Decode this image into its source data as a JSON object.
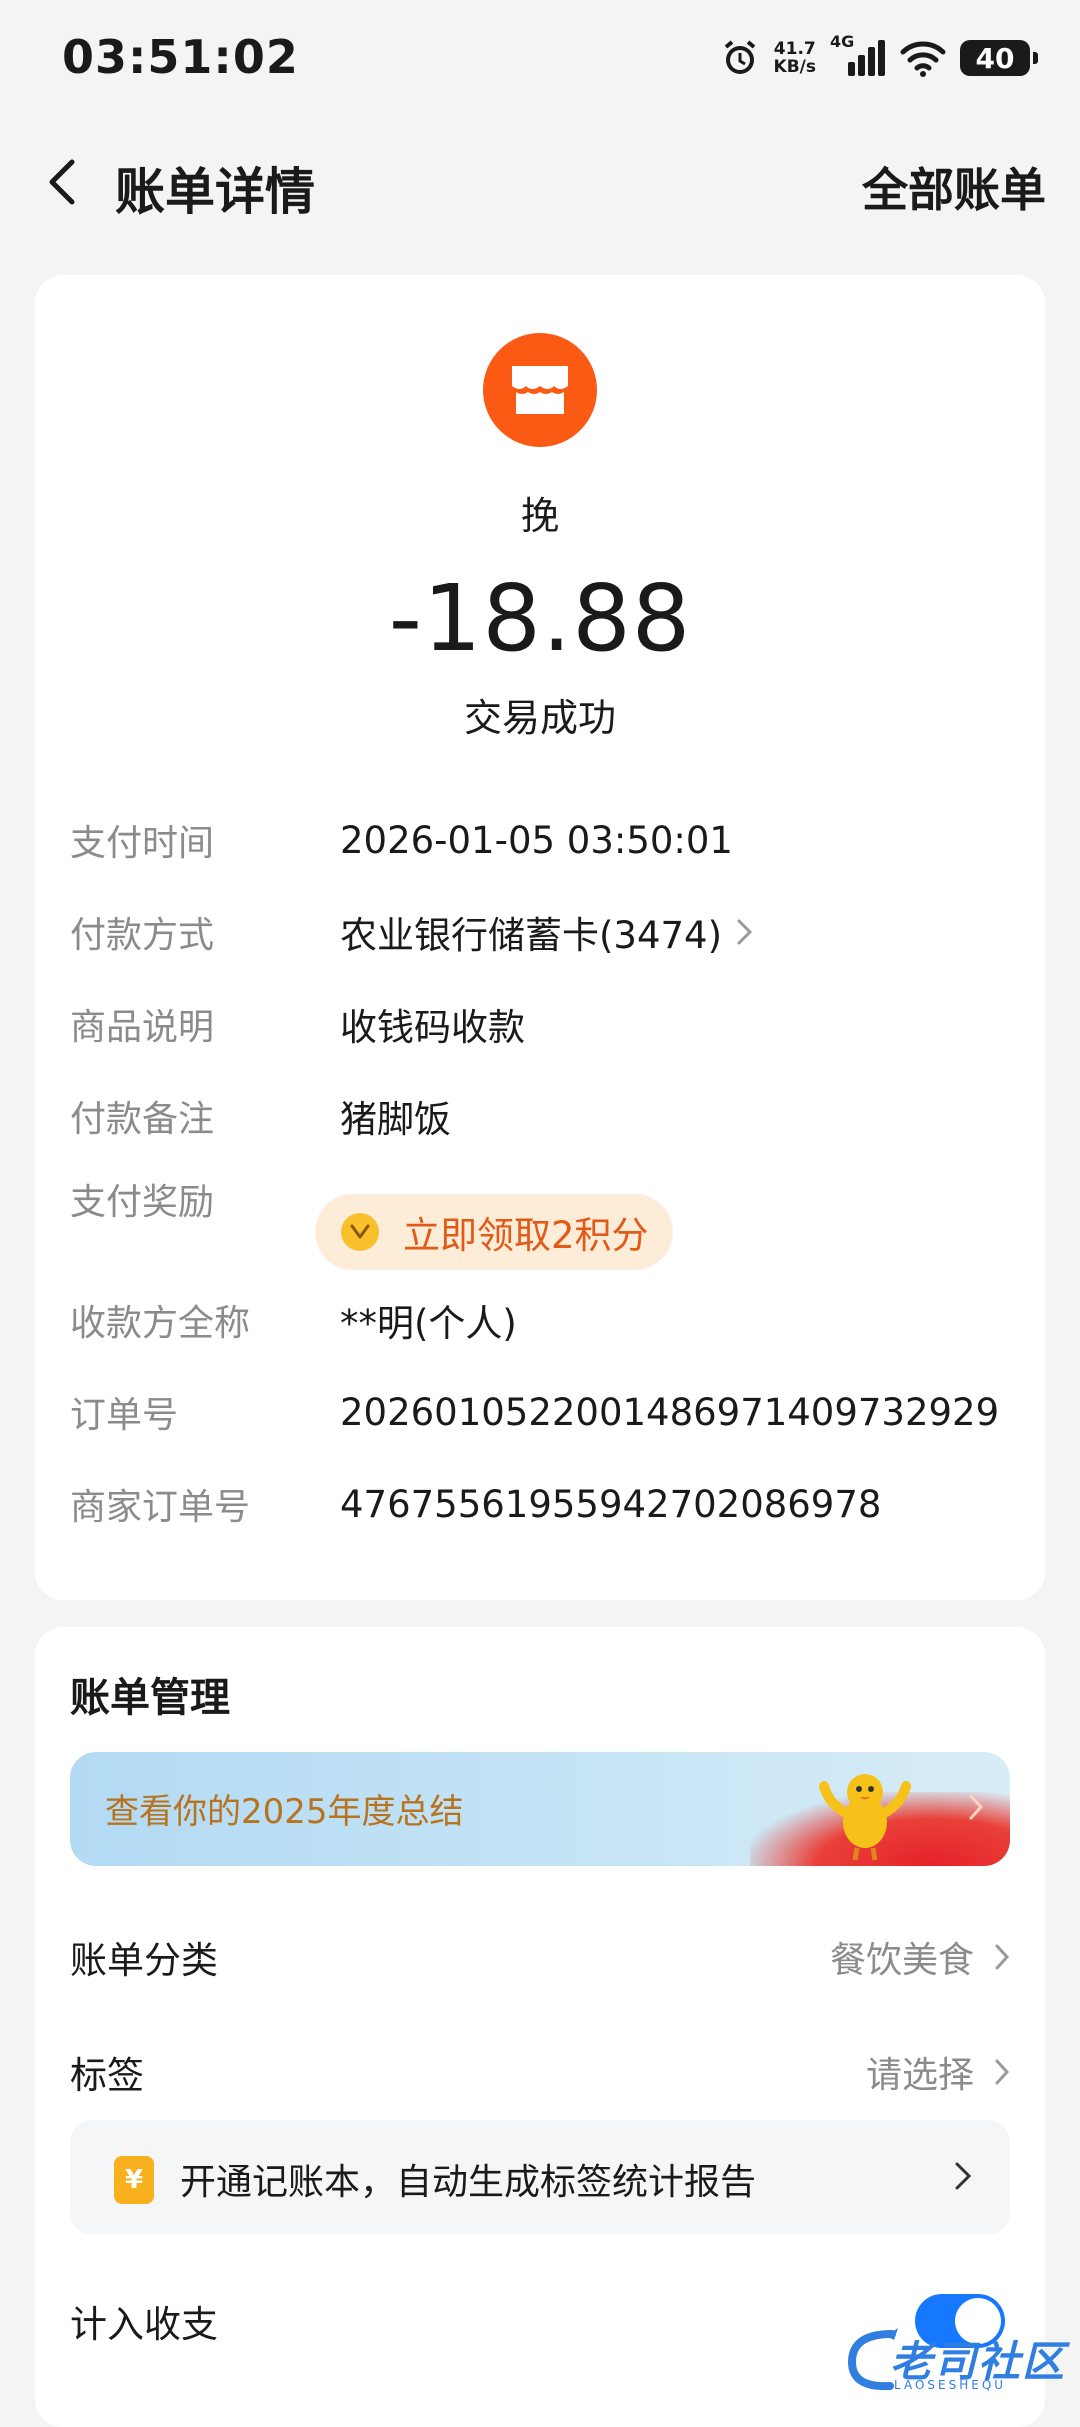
{
  "status_bar": {
    "time": "03:51:02",
    "net_speed_value": "41.7",
    "net_speed_unit": "KB/s",
    "network_type": "4G",
    "battery": "40",
    "icons": [
      "alarm-icon",
      "signal-icon",
      "wifi-icon",
      "battery-icon"
    ]
  },
  "nav": {
    "title": "账单详情",
    "right_action": "全部账单"
  },
  "transaction": {
    "merchant_name": "挽",
    "amount": "-18.88",
    "status": "交易成功",
    "merchant_icon": "store-icon",
    "accent_color": "#fa5a14"
  },
  "details": [
    {
      "label": "支付时间",
      "value": "2026-01-05 03:50:01"
    },
    {
      "label": "付款方式",
      "value": "农业银行储蓄卡(3474)"
    },
    {
      "label": "商品说明",
      "value": "收钱码收款"
    },
    {
      "label": "付款备注",
      "value": "猪脚饭"
    },
    {
      "label": "支付奖励",
      "value": "立即领取2积分"
    },
    {
      "label": "收款方全称",
      "value": "**明(个人)"
    },
    {
      "label": "订单号",
      "value": "2026010522001486971409732929"
    },
    {
      "label": "商家订单号",
      "value": "4767556195594270208697​8"
    }
  ],
  "management": {
    "title": "账单管理",
    "banner_text": "查看你的2025年度总结",
    "category_label": "账单分类",
    "category_value": "餐饮美食",
    "tag_label": "标签",
    "tag_value": "请选择",
    "promo_icon_text": "¥",
    "promo_text": "开通记账本，自动生成标签统计报告",
    "include_label": "计入收支",
    "include_on": true
  },
  "watermark": {
    "text": "老司社区",
    "sub": "LAOSESHEQU"
  }
}
